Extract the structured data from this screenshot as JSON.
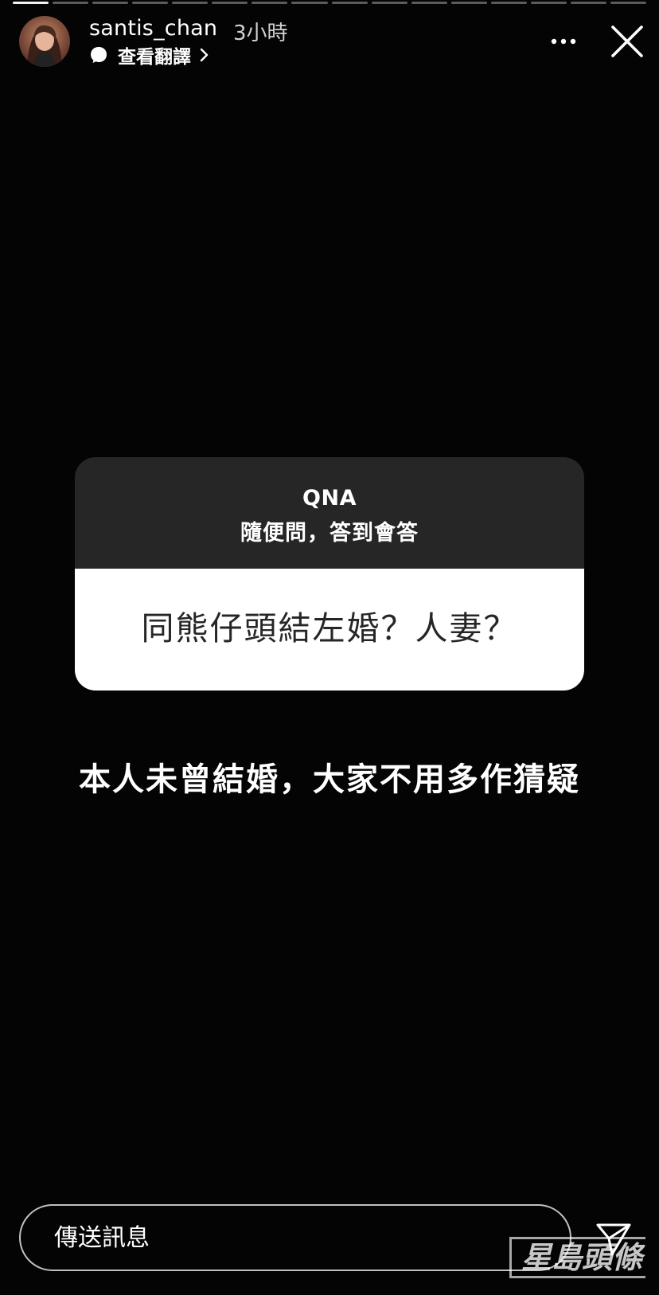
{
  "header": {
    "username": "santis_chan",
    "time": "3小時",
    "translate_label": "查看翻譯"
  },
  "progress": {
    "segments": 16,
    "current": 1
  },
  "qna": {
    "title": "QNA",
    "subtitle": "隨便問，答到會答",
    "question": "同熊仔頭結左婚？人妻？"
  },
  "answer_text": "本人未曾結婚，大家不用多作猜疑",
  "footer": {
    "message_placeholder": "傳送訊息"
  },
  "watermark": "星島頭條",
  "icons": {
    "more": "more-horizontal-icon",
    "close": "close-icon",
    "send": "send-icon",
    "translate": "chat-bubble-icon"
  },
  "colors": {
    "background": "#040404",
    "card_header": "#262626",
    "card_body": "#ffffff",
    "question_text": "#262626"
  }
}
